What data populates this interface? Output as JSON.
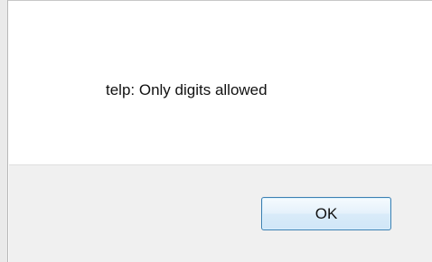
{
  "dialog": {
    "message": "telp: Only digits allowed",
    "ok_label": "OK"
  },
  "colors": {
    "button_border": "#3c7fb1",
    "footer_bg": "#f0f0f0",
    "content_bg": "#ffffff"
  }
}
